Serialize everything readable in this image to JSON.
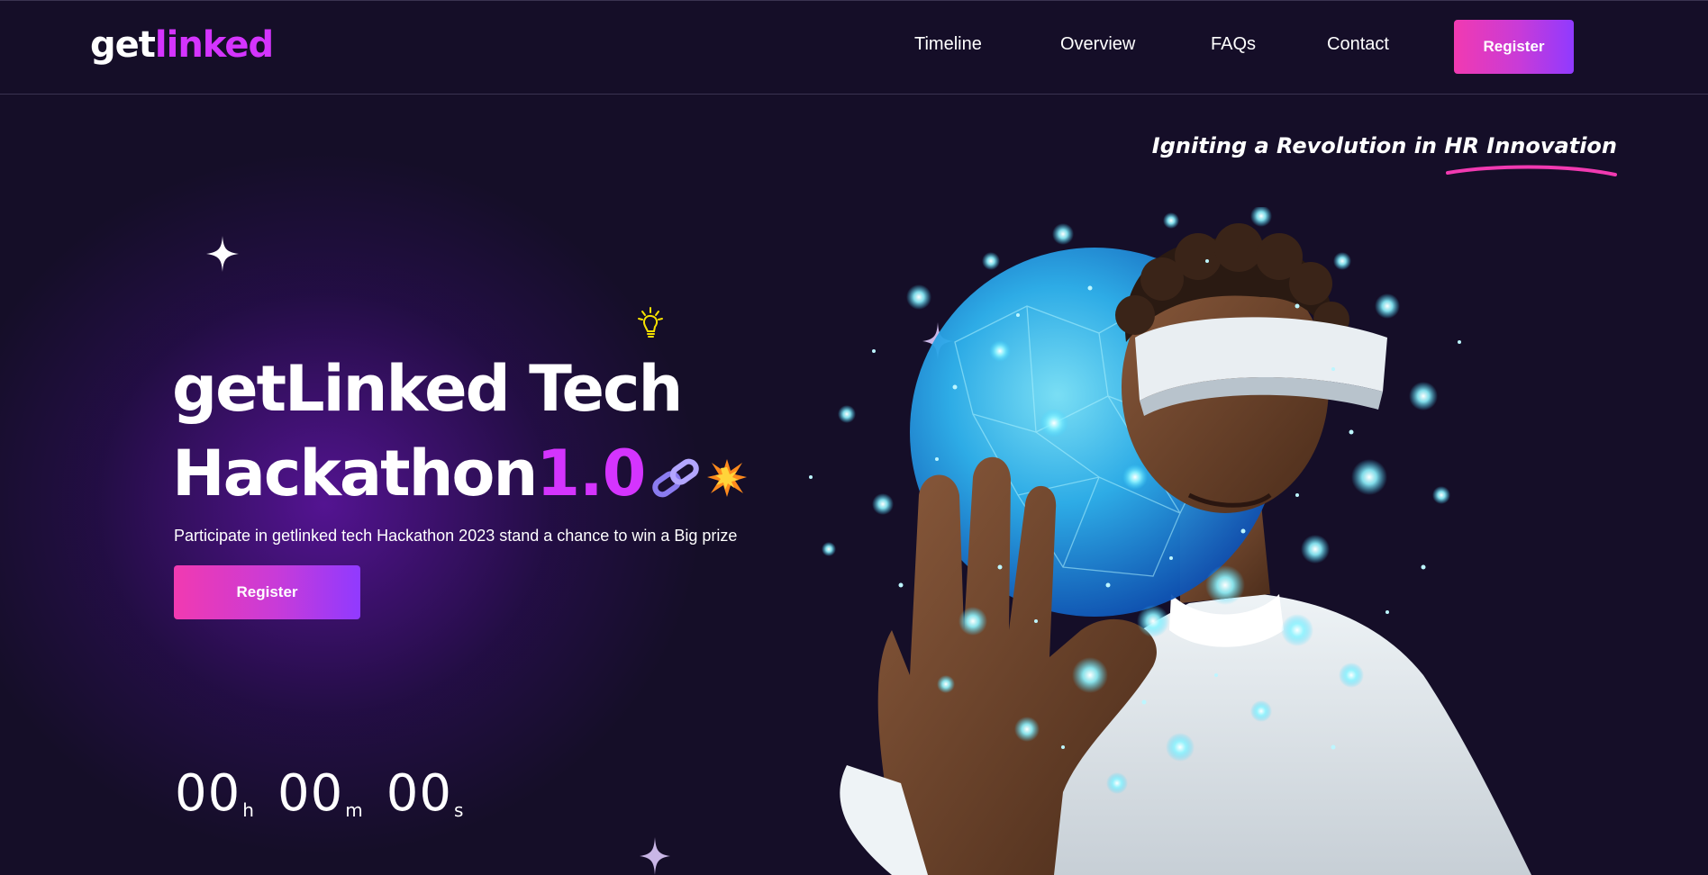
{
  "header": {
    "logo": {
      "part_a": "get",
      "part_b": "linked"
    },
    "nav": [
      {
        "label": "Timeline"
      },
      {
        "label": "Overview"
      },
      {
        "label": "FAQs"
      },
      {
        "label": "Contact"
      }
    ],
    "register_label": "Register"
  },
  "tagline": "Igniting a Revolution in HR Innovation",
  "hero": {
    "title_line1": "getLinked Tech",
    "title_line2_text": "Hackathon",
    "title_line2_version": "1.0",
    "description": "Participate in getlinked tech Hackathon 2023 stand a chance to win a Big prize",
    "register_label": "Register",
    "image_alt": "man-with-vr-headset-and-glowing-globe"
  },
  "countdown": {
    "hours": "00",
    "hours_unit": "h",
    "minutes": "00",
    "minutes_unit": "m",
    "seconds": "00",
    "seconds_unit": "s"
  },
  "icons": {
    "bulb": "lightbulb-icon",
    "chain": "chain-link-icon",
    "burst": "collision-burst-icon",
    "sparkle": "sparkle-star-icon"
  },
  "colors": {
    "background": "#150e28",
    "accent_pink": "#d434fe",
    "button_gradient_start": "#f13ab1",
    "button_gradient_end": "#903aff",
    "underline": "#f13ab1"
  }
}
